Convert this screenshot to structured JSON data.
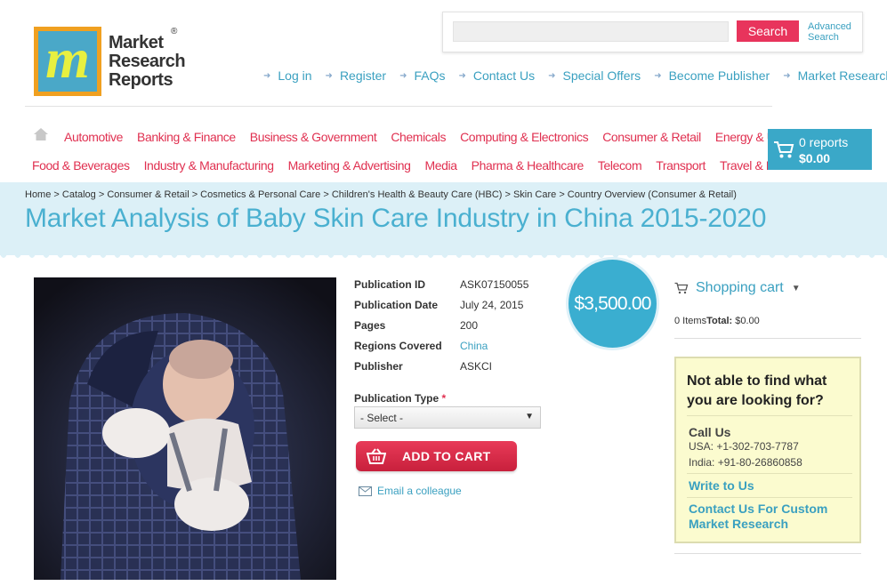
{
  "brand": {
    "logo_letter": "m",
    "logo_line1": "Market",
    "logo_line2": "Research",
    "logo_line3": "Reports",
    "registered": "®"
  },
  "search": {
    "placeholder": "",
    "button": "Search",
    "advanced_line1": "Advanced",
    "advanced_line2": "Search"
  },
  "top_links": [
    "Log in",
    "Register",
    "FAQs",
    "Contact Us",
    "Special Offers",
    "Become Publisher",
    "Market Research Blog"
  ],
  "categories_row1": [
    "Automotive",
    "Banking & Finance",
    "Business & Government",
    "Chemicals",
    "Computing & Electronics",
    "Consumer & Retail",
    "Energy & Utilities"
  ],
  "categories_row2": [
    "Food & Beverages",
    "Industry & Manufacturing",
    "Marketing & Advertising",
    "Media",
    "Pharma & Healthcare",
    "Telecom",
    "Transport",
    "Travel & Leisure"
  ],
  "cart": {
    "count": "0 reports",
    "total": "$0.00"
  },
  "breadcrumb": "Home > Catalog > Consumer & Retail > Cosmetics & Personal Care > Children's Health & Beauty Care (HBC) > Skin Care > Country Overview (Consumer & Retail)",
  "title": "Market Analysis of Baby Skin Care Industry in China 2015-2020",
  "details": [
    {
      "key": "Publication ID",
      "value": "ASK07150055"
    },
    {
      "key": "Publication Date",
      "value": "July 24, 2015"
    },
    {
      "key": "Pages",
      "value": "200"
    },
    {
      "key": "Regions Covered",
      "value": "China"
    },
    {
      "key": "Publisher",
      "value": "ASKCI"
    }
  ],
  "publication_type": {
    "label": "Publication Type",
    "required": "*",
    "selected": "- Select -"
  },
  "add_to_cart": "ADD TO CART",
  "email_colleague": "Email a colleague",
  "price": "$3,500.00",
  "shopping_cart": {
    "title": "Shopping cart",
    "items": "0 Items",
    "total_label": "Total:",
    "total_value": "$0.00"
  },
  "help": {
    "question": "Not able to find what you are looking for?",
    "call_title": "Call Us",
    "usa": "USA: +1-302-703-7787",
    "india": "India: +91-80-26860858",
    "write": "Write to Us",
    "custom": "Contact Us For Custom Market Research"
  },
  "colors": {
    "accent_blue": "#3aa8c8",
    "brand_red": "#e03050",
    "band": "#dcf0f7",
    "help_bg": "#fbfbcf"
  }
}
